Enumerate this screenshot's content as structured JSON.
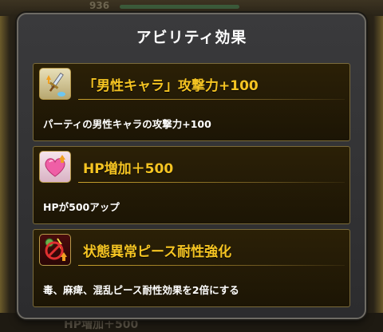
{
  "background": {
    "top_number": "936",
    "bottom_text": "HP増加＋500"
  },
  "dialog": {
    "title": "アビリティ効果"
  },
  "abilities": [
    {
      "icon": "sword-attack-up-icon",
      "name": "「男性キャラ」攻撃力+100",
      "description": "パーティの男性キャラの攻撃力+100"
    },
    {
      "icon": "heart-hp-up-icon",
      "name": "HP増加＋500",
      "description": "HPが500アップ"
    },
    {
      "icon": "status-resist-icon",
      "name": "状態異常ピース耐性強化",
      "description": "毒、麻痺、混乱ピース耐性効果を2倍にする"
    }
  ],
  "colors": {
    "ability_name": "#f5c422",
    "card_border": "#7a6a3a",
    "dialog_bg": "#333335"
  }
}
